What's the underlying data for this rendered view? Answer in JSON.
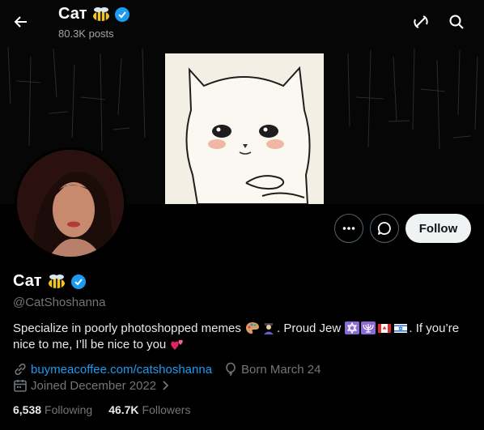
{
  "header": {
    "title": "Сат",
    "posts_count": "80.3K posts",
    "back_icon": "arrow-left-icon",
    "grok_icon": "grok-icon",
    "search_icon": "search-icon"
  },
  "profile": {
    "name": "Сат",
    "handle": "@CatShoshanna",
    "verified": true,
    "bio_text_1": "Specialize in poorly photoshopped memes",
    "bio_text_2": ". Proud Jew",
    "bio_text_3": ". If you’re nice to me, I’ll be nice to you",
    "website": "buymeacoffee.com/catshoshanna",
    "birthday": "Born March 24",
    "joined": "Joined December 2022",
    "following_count": "6,538",
    "following_label": "Following",
    "followers_count": "46.7K",
    "followers_label": "Followers"
  },
  "actions": {
    "follow_label": "Follow",
    "more_icon": "more-icon",
    "message_icon": "message-icon"
  },
  "colors": {
    "accent": "#1d9bf0",
    "muted": "#71767b",
    "follow_bg": "#eff3f4"
  }
}
